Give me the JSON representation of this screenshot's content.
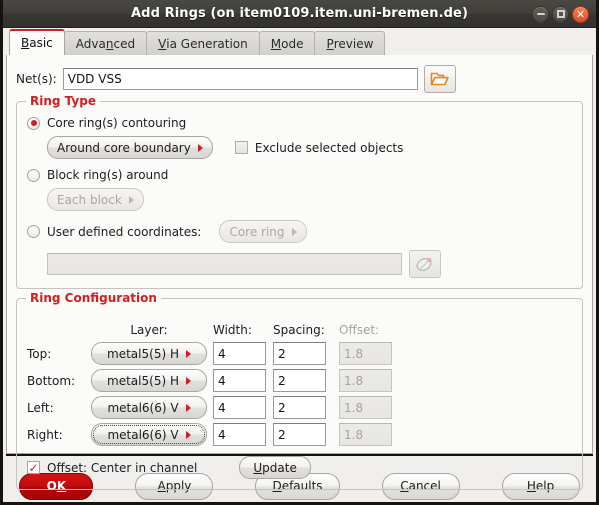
{
  "window": {
    "title": "Add Rings (on item0109.item.uni-bremen.de)",
    "controls": {
      "minimize": "minimize-button",
      "maximize": "maximize-button",
      "close": "close-button"
    }
  },
  "tabs": [
    {
      "label": "Basic",
      "mnemonic": "B",
      "active": true
    },
    {
      "label": "Advanced",
      "mnemonic": "n",
      "active": false
    },
    {
      "label": "Via Generation",
      "mnemonic": "V",
      "active": false
    },
    {
      "label": "Mode",
      "mnemonic": "M",
      "active": false
    },
    {
      "label": "Preview",
      "mnemonic": "P",
      "active": false
    }
  ],
  "nets": {
    "label": "Net(s):",
    "value": "VDD VSS",
    "placeholder": "",
    "browse_icon": "folder-open-icon"
  },
  "ring_type": {
    "title": "Ring Type",
    "options": [
      {
        "label": "Core ring(s) contouring",
        "selected": true,
        "combo": "Around core boundary",
        "combo_enabled": true
      },
      {
        "label": "Block ring(s) around",
        "selected": false,
        "combo": "Each block",
        "combo_enabled": false
      },
      {
        "label": "User defined coordinates:",
        "selected": false,
        "combo": "Core ring",
        "combo_enabled": false
      }
    ],
    "exclude_checkbox": {
      "label": "Exclude selected objects",
      "checked": false
    },
    "coordinates": {
      "value": "",
      "placeholder": "",
      "pick_icon": "mouse-pointer-icon"
    }
  },
  "ring_config": {
    "title": "Ring Configuration",
    "headers": {
      "layer": "Layer:",
      "width": "Width:",
      "spacing": "Spacing:",
      "offset": "Offset:"
    },
    "rows": [
      {
        "side": "Top:",
        "layer": "metal5(5) H",
        "width": "4",
        "spacing": "2",
        "offset": "1.8",
        "focused": false
      },
      {
        "side": "Bottom:",
        "layer": "metal5(5) H",
        "width": "4",
        "spacing": "2",
        "offset": "1.8",
        "focused": false
      },
      {
        "side": "Left:",
        "layer": "metal6(6) V",
        "width": "4",
        "spacing": "2",
        "offset": "1.8",
        "focused": false
      },
      {
        "side": "Right:",
        "layer": "metal6(6) V",
        "width": "4",
        "spacing": "2",
        "offset": "1.8",
        "focused": true
      }
    ],
    "offset_checkbox": {
      "label": "Offset: Center in channel",
      "checked": true
    },
    "update_button": {
      "label": "Update",
      "mnemonic": "U"
    }
  },
  "footer": {
    "buttons": [
      {
        "label": "OK",
        "mnemonic": "K",
        "primary": true
      },
      {
        "label": "Apply",
        "mnemonic": "A",
        "primary": false
      },
      {
        "label": "Defaults",
        "mnemonic": "D",
        "primary": false
      },
      {
        "label": "Cancel",
        "mnemonic": "C",
        "primary": false
      },
      {
        "label": "Help",
        "mnemonic": "H",
        "primary": false
      }
    ]
  },
  "colors": {
    "accent_red": "#cf1f1f",
    "titlebar": "#3d3b36",
    "panel_bg": "#fbfbfa",
    "dialog_bg": "#f0efee",
    "close_button": "#df4c21"
  }
}
